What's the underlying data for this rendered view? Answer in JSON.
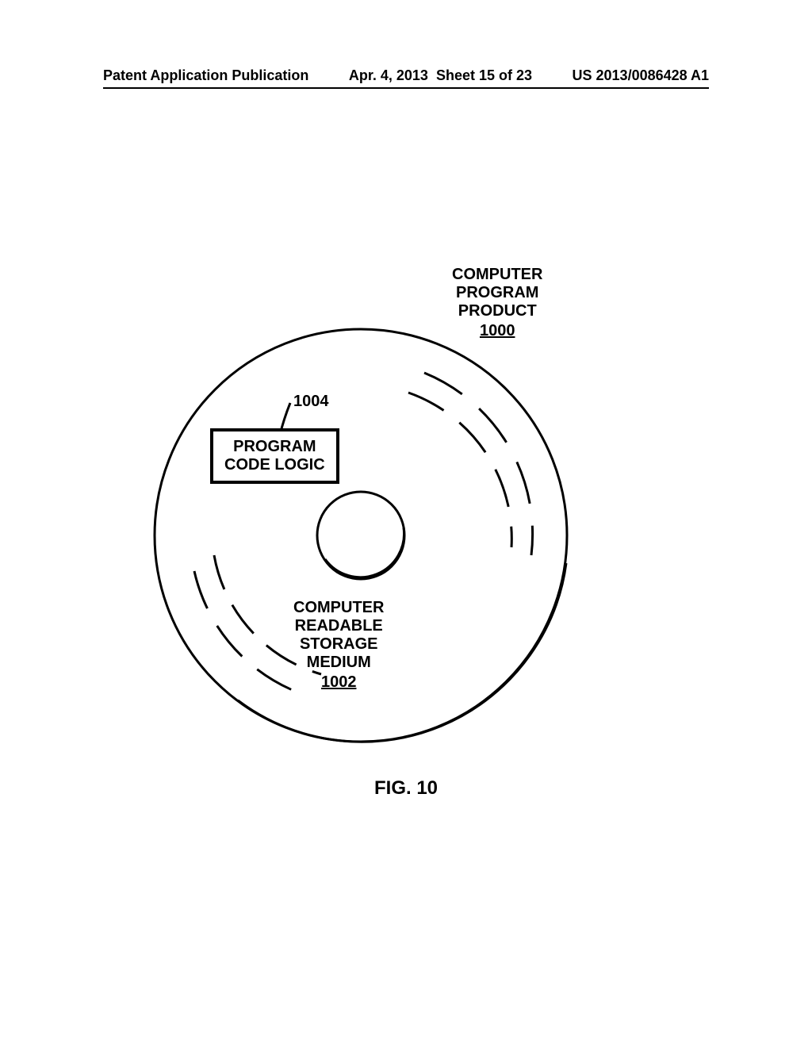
{
  "header": {
    "publication": "Patent Application Publication",
    "date": "Apr. 4, 2013",
    "sheet": "Sheet 15 of 23",
    "pubnum": "US 2013/0086428 A1"
  },
  "figure": {
    "caption": "FIG. 10",
    "product_label_line1": "COMPUTER",
    "product_label_line2": "PROGRAM",
    "product_label_line3": "PRODUCT",
    "product_ref": "1000",
    "code_ref": "1004",
    "code_box_line1": "PROGRAM",
    "code_box_line2": "CODE LOGIC",
    "medium_line1": "COMPUTER",
    "medium_line2": "READABLE",
    "medium_line3": "STORAGE",
    "medium_line4": "MEDIUM",
    "medium_ref": "1002"
  }
}
